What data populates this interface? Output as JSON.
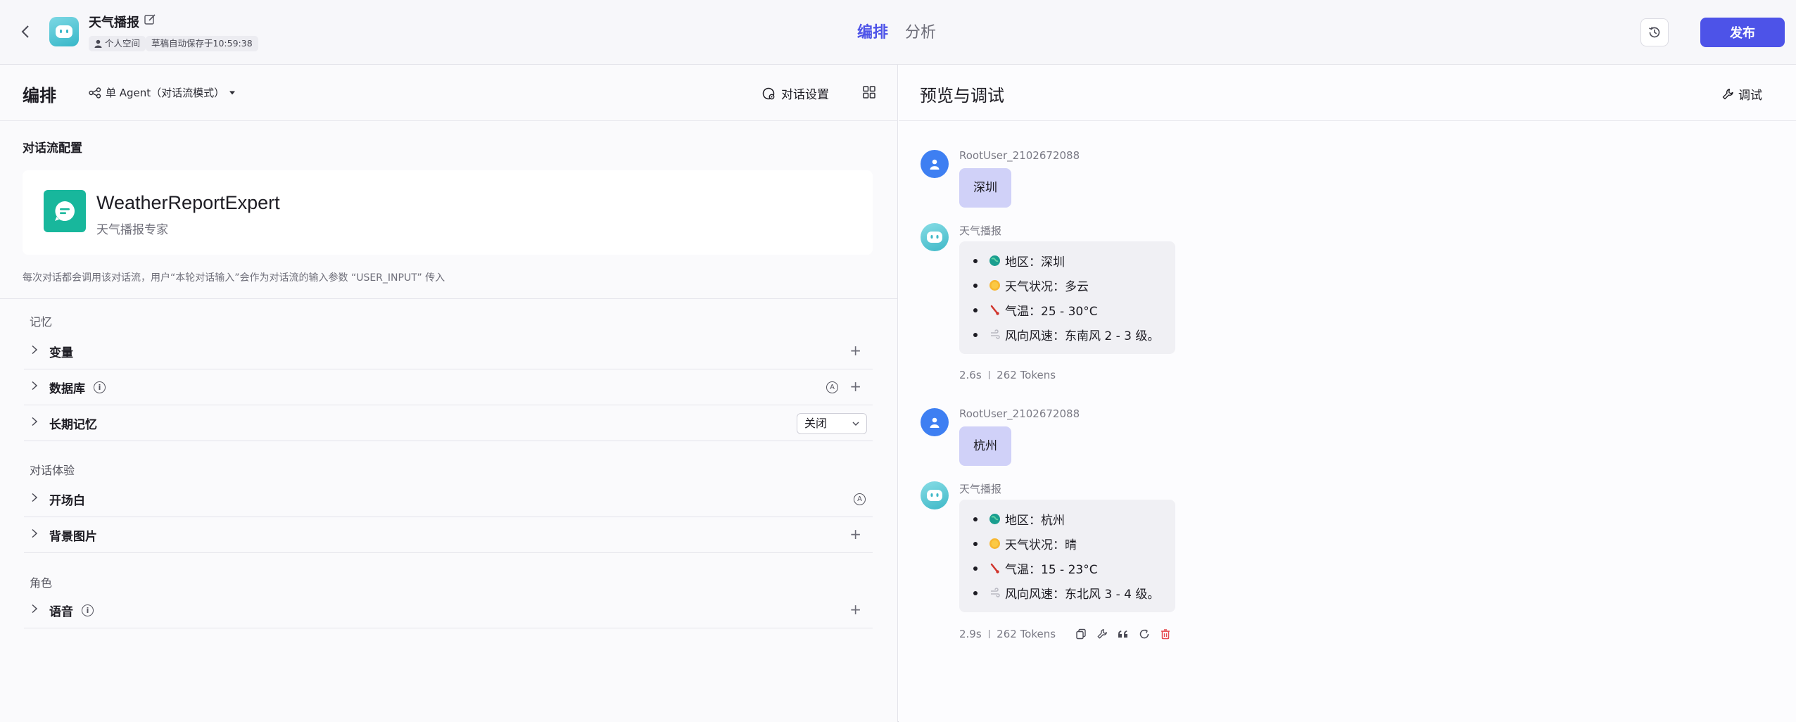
{
  "header": {
    "app_title": "天气播报",
    "tag_space": "个人空间",
    "tag_autosave": "草稿自动保存于10:59:38",
    "tabs": [
      {
        "label": "编排",
        "active": true
      },
      {
        "label": "分析",
        "active": false
      }
    ],
    "publish_label": "发布"
  },
  "left": {
    "title": "编排",
    "mode": "单 Agent（对话流模式）",
    "dialog_settings": "对话设置",
    "flow_section": "对话流配置",
    "flow": {
      "name": "WeatherReportExpert",
      "desc": "天气播报专家",
      "note": "每次对话都会调用该对话流，用户“本轮对话输入”会作为对话流的输入参数 “USER_INPUT” 传入"
    },
    "memory_group": "记忆",
    "memory_rows": [
      "变量",
      "数据库",
      "长期记忆"
    ],
    "long_memory_value": "关闭",
    "experience_group": "对话体验",
    "experience_rows": [
      "开场白",
      "背景图片"
    ],
    "role_group": "角色",
    "role_rows": [
      "语音"
    ]
  },
  "right": {
    "title": "预览与调试",
    "debug_label": "调试",
    "messages": [
      {
        "role": "user",
        "name": "RootUser_2102672088",
        "text": "深圳"
      },
      {
        "role": "bot",
        "name": "天气播报",
        "items": [
          "地区：深圳",
          "天气状况：多云",
          "气温：25 - 30°C",
          "风向风速：东南风 2 - 3 级。"
        ],
        "time": "2.6s",
        "tokens": "262 Tokens"
      },
      {
        "role": "user",
        "name": "RootUser_2102672088",
        "text": "杭州"
      },
      {
        "role": "bot",
        "name": "天气播报",
        "items": [
          "地区：杭州",
          "天气状况：晴",
          "气温：15 - 23°C",
          "风向风速：东北风 3 - 4 级。"
        ],
        "time": "2.9s",
        "tokens": "262 Tokens"
      }
    ]
  },
  "colors": {
    "accent": "#4d53e8",
    "user_bubble": "#d0d1f8",
    "bot_bubble": "#f0f0f4",
    "flow_icon": "#18b79c",
    "delete_red": "#e5484d"
  },
  "icons": [
    "back-icon",
    "bot-avatar-icon",
    "edit-icon",
    "user-icon",
    "history-icon",
    "agent-mode-icon",
    "caret-down-icon",
    "settings-chat-icon",
    "grid-icon",
    "chat-flow-icon",
    "chevron-right-icon",
    "plus-icon",
    "info-icon",
    "auto-icon",
    "wrench-icon",
    "globe-icon",
    "sun-icon",
    "thermometer-icon",
    "wind-icon",
    "copy-icon",
    "quote-icon",
    "refresh-icon",
    "delete-icon"
  ]
}
